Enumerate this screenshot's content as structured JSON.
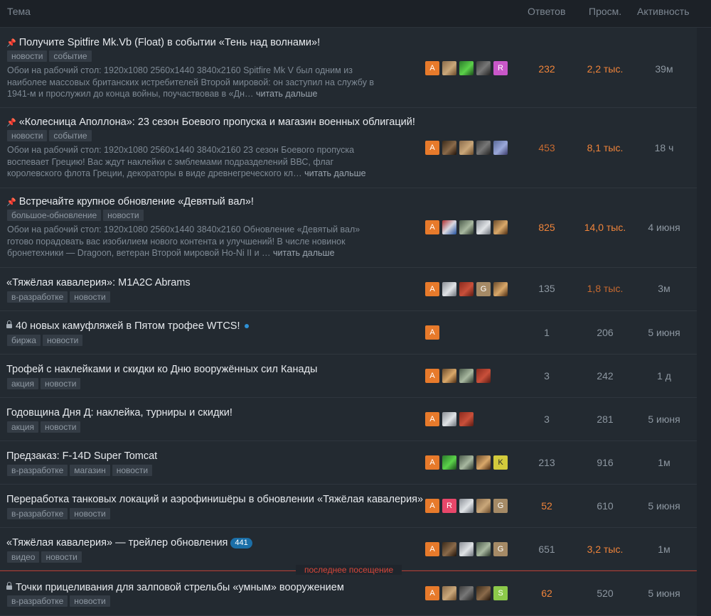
{
  "header": {
    "topic": "Тема",
    "replies": "Ответов",
    "views": "Просм.",
    "activity": "Активность"
  },
  "last_visit_label": "последнее посещение",
  "topics": [
    {
      "title": "Получите Spitfire Mk.Vb (Float) в событии «Тень над волнами»!",
      "icon": "pin-icon",
      "tags": [
        "новости",
        "событие"
      ],
      "excerpt": "Обои на рабочий стол: 1920x1080 2560x1440 3840x2160 Spitfire Mk V был одним из наиболее массовых британских истребителей Второй мировой: он заступил на службу в 1941-м и прослужил до конца войны, поучаствовав в «Дн…",
      "more": "читать дальше",
      "avatars": [
        "A",
        "img1",
        "img2",
        "img3",
        "R"
      ],
      "replies": "232",
      "views": "2,2 тыс.",
      "activity": "39м"
    },
    {
      "title": "«Колесница Аполлона»: 23 сезон Боевого пропуска и магазин военных облигаций!",
      "icon": "pin-icon",
      "tags": [
        "новости",
        "событие"
      ],
      "excerpt": "Обои на рабочий стол: 1920x1080 2560x1440 3840x2160 23 сезон Боевого пропуска воспевает Грецию! Вас ждут наклейки с эмблемами подразделений ВВС, флаг королевского флота Греции, декораторы в виде древнегреческого кл…",
      "more": "читать дальше",
      "avatars": [
        "A",
        "img10",
        "img1",
        "img3",
        "img4"
      ],
      "replies": "453",
      "views": "8,1 тыс.",
      "activity": "18 ч"
    },
    {
      "title": "Встречайте крупное обновление «Девятый вал»!",
      "icon": "pin-icon",
      "tags": [
        "большое-обновление",
        "новости"
      ],
      "excerpt": "Обои на рабочий стол: 1920x1080 2560x1440 3840x2160 Обновление «Девятый вал» готово порадовать вас изобилием нового контента и улучшений! В числе новинок бронетехники — Dragoon, ветеран Второй мировой Ho-Ni II и …",
      "more": "читать дальше",
      "avatars": [
        "A",
        "img5",
        "img8",
        "img6",
        "img9"
      ],
      "replies": "825",
      "views": "14,0 тыс.",
      "activity": "4 июня"
    },
    {
      "title": "«Тяжёлая кавалерия»: M1A2C Abrams",
      "icon": "",
      "tags": [
        "в-разработке",
        "новости"
      ],
      "avatars": [
        "A",
        "img6",
        "img7",
        "G",
        "img9"
      ],
      "replies": "135",
      "views": "1,8 тыс.",
      "activity": "3м"
    },
    {
      "title": "40 новых камуфляжей в Пятом трофее WTCS!",
      "icon": "lock-icon",
      "dot": true,
      "tags": [
        "биржа",
        "новости"
      ],
      "avatars": [
        "A"
      ],
      "replies": "1",
      "views": "206",
      "activity": "5 июня"
    },
    {
      "title": "Трофей с наклейками и скидки ко Дню вооружённых сил Канады",
      "icon": "",
      "tags": [
        "акция",
        "новости"
      ],
      "avatars": [
        "A",
        "img9",
        "img8",
        "img7"
      ],
      "replies": "3",
      "views": "242",
      "activity": "1 д"
    },
    {
      "title": "Годовщина Дня Д: наклейка, турниры и скидки!",
      "icon": "",
      "tags": [
        "акция",
        "новости"
      ],
      "avatars": [
        "A",
        "img6",
        "img7"
      ],
      "replies": "3",
      "views": "281",
      "activity": "5 июня"
    },
    {
      "title": "Предзаказ: F-14D Super Tomcat",
      "icon": "",
      "tags": [
        "в-разработке",
        "магазин",
        "новости"
      ],
      "avatars": [
        "A",
        "img2",
        "img8",
        "img9",
        "K"
      ],
      "replies": "213",
      "views": "916",
      "activity": "1м"
    },
    {
      "title": "Переработка танковых локаций и аэрофинишёры в обновлении «Тяжёлая кавалерия»",
      "icon": "",
      "tags": [
        "в-разработке",
        "новости"
      ],
      "avatars": [
        "A",
        "R",
        "img6",
        "img1",
        "G"
      ],
      "replies": "52",
      "views": "610",
      "activity": "5 июня"
    },
    {
      "title": "«Тяжёлая кавалерия» — трейлер обновления",
      "icon": "",
      "badge": "441",
      "tags": [
        "видео",
        "новости"
      ],
      "avatars": [
        "A",
        "img10",
        "img6",
        "img8",
        "G"
      ],
      "replies": "651",
      "views": "3,2 тыс.",
      "activity": "1м"
    },
    {
      "title": "Точки прицеливания для залповой стрельбы «умным» вооружением",
      "icon": "lock-icon",
      "tags": [
        "в-разработке",
        "новости"
      ],
      "avatars": [
        "A",
        "img1",
        "img3",
        "img10",
        "S"
      ],
      "replies": "62",
      "views": "520",
      "activity": "5 июня"
    }
  ],
  "colors": {
    "hot": "#f0843a",
    "warm": "#c76a30",
    "normal": "#8d97a1",
    "tag_bg": "#343c45",
    "last_visit": "#d9473a"
  }
}
